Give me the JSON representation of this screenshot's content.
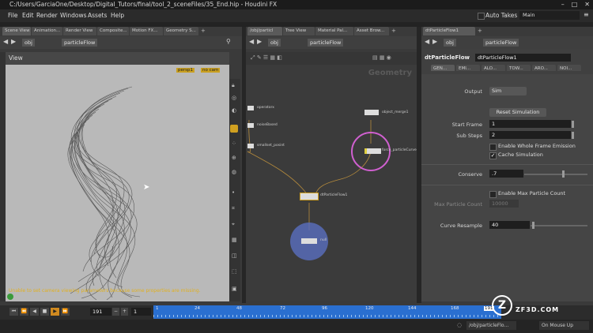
{
  "window": {
    "title": "C:/Users/GarciaOne/Desktop/Digital_Tutors/final/tool_2_sceneFiles/35_End.hip - Houdini FX"
  },
  "menu": {
    "items": [
      "File",
      "Edit",
      "Render",
      "Windows",
      "Assets",
      "Help"
    ],
    "auto_takes_label": "Auto Takes",
    "desktop_value": "Main"
  },
  "left_pane": {
    "tabs": [
      "Scene View",
      "Animation...",
      "Render View",
      "Composite...",
      "Motion FX...",
      "Geometry S..."
    ],
    "path_root": "obj",
    "path_node": "particleFlow",
    "view_label": "View",
    "persp_label": "persp1",
    "cam_label": "no cam",
    "warning": "Unable to set camera viewing parameters because some properties are missing."
  },
  "network_pane": {
    "tabs": [
      "/obj/particl",
      "Tree View",
      "Material Pal...",
      "Asset Brow..."
    ],
    "path_root": "obj",
    "path_node": "particleFlow",
    "context_label": "Geometry",
    "nodes": [
      "operatorx",
      "noiseBased",
      "smallset_posint",
      "object_merge1",
      "force_particleCurve",
      "dtParticleFlow1",
      "null"
    ]
  },
  "param_pane": {
    "tab_title": "dtParticleFlow1",
    "type_label": "dtParticleFlow",
    "node_name": "dtParticleFlow1",
    "tabs": [
      "GEN...",
      "EMI...",
      "ALO...",
      "TOW...",
      "ARO...",
      "NOI..."
    ],
    "output_label": "Output",
    "output_value": "Sim",
    "reset_button": "Reset Simulation",
    "start_frame_label": "Start Frame",
    "start_frame_value": "1",
    "sub_steps_label": "Sub Steps",
    "sub_steps_value": "2",
    "enable_whole_frame_label": "Enable Whole Frame Emission",
    "cache_sim_label": "Cache Simulation",
    "conserve_label": "Conserve",
    "conserve_value": ".7",
    "enable_max_label": "Enable Max Particle Count",
    "max_count_label": "Max Particle Count",
    "max_count_value": "10000",
    "curve_resample_label": "Curve Resample",
    "curve_resample_value": "40"
  },
  "timeline": {
    "current_frame": "191",
    "step_value": "1",
    "ticks": [
      "1",
      "24",
      "48",
      "72",
      "96",
      "120",
      "144",
      "168",
      "191"
    ],
    "status_path": "/obj/particleFlo...",
    "status_mode": "On Mouse Up"
  },
  "watermark": {
    "site": "ZF3D.COM"
  },
  "colors": {
    "selected_node_ring": "#d060d0",
    "output_node_ring": "#5a6fc0",
    "timeline_blue": "#2a6fd0",
    "node_wire": "#b48a3c"
  }
}
